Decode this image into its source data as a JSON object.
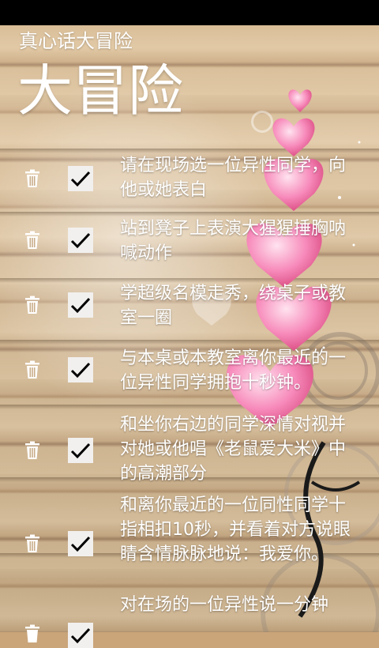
{
  "app": {
    "title": "真心话大冒险",
    "page_title": "大冒险"
  },
  "colors": {
    "text": "#ffffff",
    "checkbox_bg": "#f2f0ee",
    "status_bar": "#000000"
  },
  "items": [
    {
      "text": "请在现场选一位异性同学，向他或她表白",
      "checked": true
    },
    {
      "text": "站到凳子上表演大猩猩捶胸呐喊动作",
      "checked": true
    },
    {
      "text": "学超级名模走秀，绕桌子或教室一圈",
      "checked": true
    },
    {
      "text": "与本桌或本教室离你最近的一位异性同学拥抱十秒钟。",
      "checked": true
    },
    {
      "text": "和坐你右边的同学深情对视并对她或他唱《老鼠爱大米》中的高潮部分",
      "checked": true
    },
    {
      "text": "和离你最近的一位同性同学十指相扣10秒，并看着对方说眼睛含情脉脉地说：我爱你。",
      "checked": true
    },
    {
      "text": "对在场的一位异性说一分钟",
      "checked": true
    }
  ],
  "icons": {
    "delete": "trash-icon",
    "check": "checkmark-icon"
  }
}
